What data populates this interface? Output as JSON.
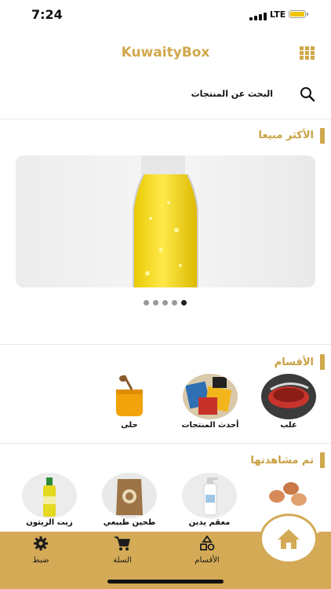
{
  "status_bar": {
    "time": "7:24",
    "network": "LTE"
  },
  "header": {
    "title": "KuwaityBox",
    "menu_icon": "grid-icon"
  },
  "search": {
    "placeholder": "البحث عن المنتجات",
    "icon": "search-icon"
  },
  "best_sellers": {
    "title": "الأكثر مبيعا",
    "carousel": {
      "pages": 5,
      "active_index": 4
    }
  },
  "categories": {
    "title": "الأقسام",
    "items": [
      {
        "label": "علب",
        "icon": "boxes-icon"
      },
      {
        "label": "أحدث المنتجات",
        "icon": "newest-products-icon"
      },
      {
        "label": "حلى",
        "icon": "honey-jar-icon"
      }
    ]
  },
  "recently_viewed": {
    "title": "تم مشاهدتها",
    "items": [
      {
        "label": "",
        "icon": "eggs-icon"
      },
      {
        "label": "معقم يدين",
        "icon": "hand-sanitizer-icon"
      },
      {
        "label": "طحين طبيعي",
        "icon": "flour-bag-icon"
      },
      {
        "label": "زيت الزيتون",
        "icon": "olive-oil-icon"
      }
    ]
  },
  "bottom_nav": {
    "items": [
      {
        "label": "ضبط",
        "icon": "gear-icon"
      },
      {
        "label": "السلة",
        "icon": "cart-icon"
      },
      {
        "label": "الأقسام",
        "icon": "shapes-icon"
      }
    ],
    "home_icon": "home-icon"
  },
  "colors": {
    "accent": "#d0a84c",
    "nav_bar": "#d4aa56",
    "text": "#111111"
  }
}
